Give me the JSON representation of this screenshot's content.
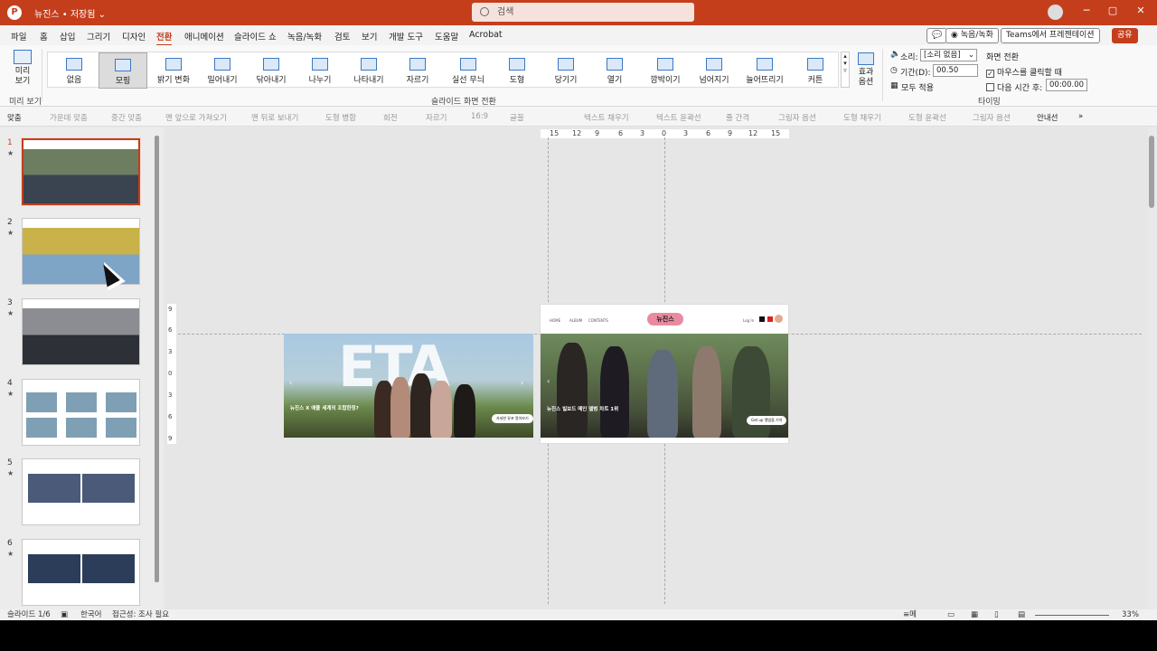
{
  "titlebar": {
    "logo": "P",
    "doc_name": "뉴진스 ",
    "save_state": "• 저장됨",
    "search_placeholder": "검색",
    "min": "─",
    "restore": "▢",
    "close": "✕"
  },
  "menu": {
    "tabs": [
      "파일",
      "홈",
      "삽입",
      "그리기",
      "디자인",
      "전환",
      "애니메이션",
      "슬라이드 쇼",
      "녹음/녹화",
      "검토",
      "보기",
      "개발 도구",
      "도움말",
      "Acrobat"
    ],
    "active": "전환",
    "comment_btn": "💬",
    "record_btn": "◉ 녹음/녹화",
    "teams_btn": "Teams에서 프레젠테이션",
    "share_btn": "공유"
  },
  "ribbon": {
    "preview_label": "미리\n보기",
    "preview_group": "미리 보기",
    "transitions": [
      "없음",
      "모핑",
      "밝기 변화",
      "밀어내기",
      "닦아내기",
      "나누기",
      "나타내기",
      "자르기",
      "실선 무늬",
      "도형",
      "당기기",
      "열기",
      "깜박이기",
      "넘어지기",
      "늘어뜨리기",
      "커튼"
    ],
    "selected_transition": "모핑",
    "transitions_group": "슬라이드 화면 전환",
    "effect_label": "효과\n옵션",
    "timing": {
      "sound_label": "소리:",
      "sound_value": "[소리 없음]",
      "duration_label": "기간(D):",
      "duration_value": "00.50",
      "apply_all": "모두 적용",
      "advance_title": "화면 전환",
      "on_click": "마우스를 클릭할 때",
      "after": "다음 시간 후:",
      "after_value": "00:00.00",
      "group": "타이밍"
    }
  },
  "toolbar2": {
    "items": [
      "맞춤",
      "가운데 맞춤",
      "중간 맞춤",
      "맨 앞으로 가져오기",
      "맨 뒤로 보내기",
      "도형 병합",
      "회전",
      "자르기",
      "16:9",
      "글꼴",
      "텍스트 채우기",
      "텍스트 윤곽선",
      "줄 간격",
      "그림자 옵션",
      "도형 채우기",
      "도형 윤곽선",
      "그림자 옵션",
      "안내선",
      "»"
    ]
  },
  "thumbnails": {
    "slides": [
      {
        "num": "1",
        "star": "★"
      },
      {
        "num": "2",
        "star": "★"
      },
      {
        "num": "3",
        "star": "★"
      },
      {
        "num": "4",
        "star": "★"
      },
      {
        "num": "5",
        "star": "★"
      },
      {
        "num": "6",
        "star": "★"
      }
    ],
    "active_index": 0
  },
  "canvas": {
    "ruler_h": [
      "15",
      "12",
      "9",
      "6",
      "3",
      "0",
      "3",
      "6",
      "9",
      "12",
      "15"
    ],
    "ruler_v": [
      "9",
      "6",
      "3",
      "0",
      "3",
      "6",
      "9"
    ],
    "left_slide": {
      "big_text": "ETA",
      "headline": "뉴진스 X 애플 세계의 조합한정?",
      "cta": "자세한 뮤포 알아보기"
    },
    "right_slide": {
      "nav": [
        "HOME",
        "ALBUM",
        "CONTENTS"
      ],
      "brand": "뉴진스",
      "login": "Log In",
      "headline": "뉴진스 빌보드 메인 앨범 차트 1위",
      "cta": "Get up 앨범을 기억"
    }
  },
  "statusbar": {
    "slide": "슬라이드 1/6",
    "lang": "한국어",
    "access": "접근성: 조사 필요",
    "notes": "메모",
    "zoom": "33%"
  },
  "colors": {
    "accent": "#c43e1c",
    "ribbon_bg": "#f9f9f9",
    "canvas_bg": "#e6e6e6"
  }
}
